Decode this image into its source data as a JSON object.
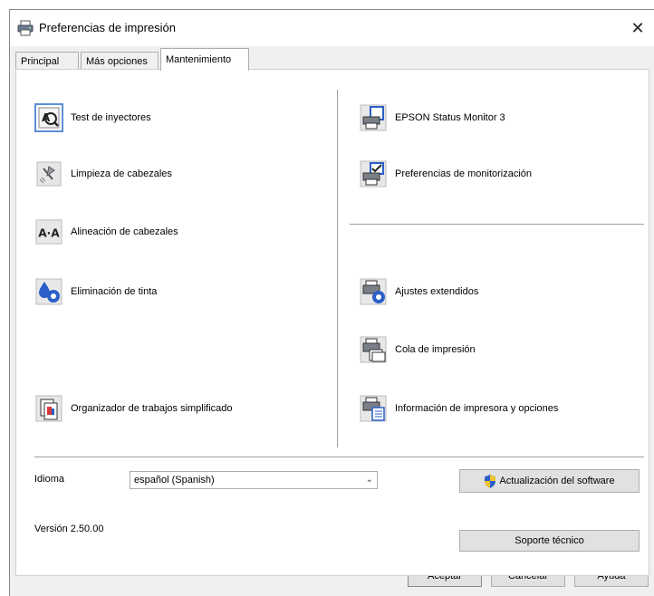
{
  "window": {
    "title": "Preferencias de impresión",
    "close_label": "✕"
  },
  "tabs": [
    {
      "label": "Principal",
      "active": false
    },
    {
      "label": "Más opciones",
      "active": false
    },
    {
      "label": "Mantenimiento",
      "active": true
    }
  ],
  "left_items": [
    {
      "label": "Test de inyectores",
      "icon": "nozzle-check-icon"
    },
    {
      "label": "Limpieza de cabezales",
      "icon": "head-cleaning-icon"
    },
    {
      "label": "Alineación de cabezales",
      "icon": "head-alignment-icon",
      "icon_text": "A·A"
    },
    {
      "label": "Eliminación de tinta",
      "icon": "ink-flush-icon"
    },
    {
      "label": "Organizador de trabajos simplificado",
      "icon": "job-arranger-icon"
    }
  ],
  "right_items": [
    {
      "label": "EPSON Status Monitor 3",
      "icon": "status-monitor-icon"
    },
    {
      "label": "Preferencias de monitorización",
      "icon": "monitoring-preferences-icon"
    },
    {
      "label": "Ajustes extendidos",
      "icon": "extended-settings-icon"
    },
    {
      "label": "Cola de impresión",
      "icon": "print-queue-icon"
    },
    {
      "label": "Información de impresora y opciones",
      "icon": "printer-info-icon"
    }
  ],
  "language": {
    "label": "Idioma",
    "selected": "español (Spanish)"
  },
  "software_update_label": "Actualización del software",
  "version": "Versión 2.50.00",
  "support_label": "Soporte técnico",
  "footer": {
    "ok_label": "Aceptar",
    "cancel_label": "Cancelar",
    "help_label": "Ayuda"
  },
  "colors": {
    "accent": "#5b8fd4",
    "shield_blue": "#2a5fc8",
    "shield_yellow": "#f2c230"
  }
}
